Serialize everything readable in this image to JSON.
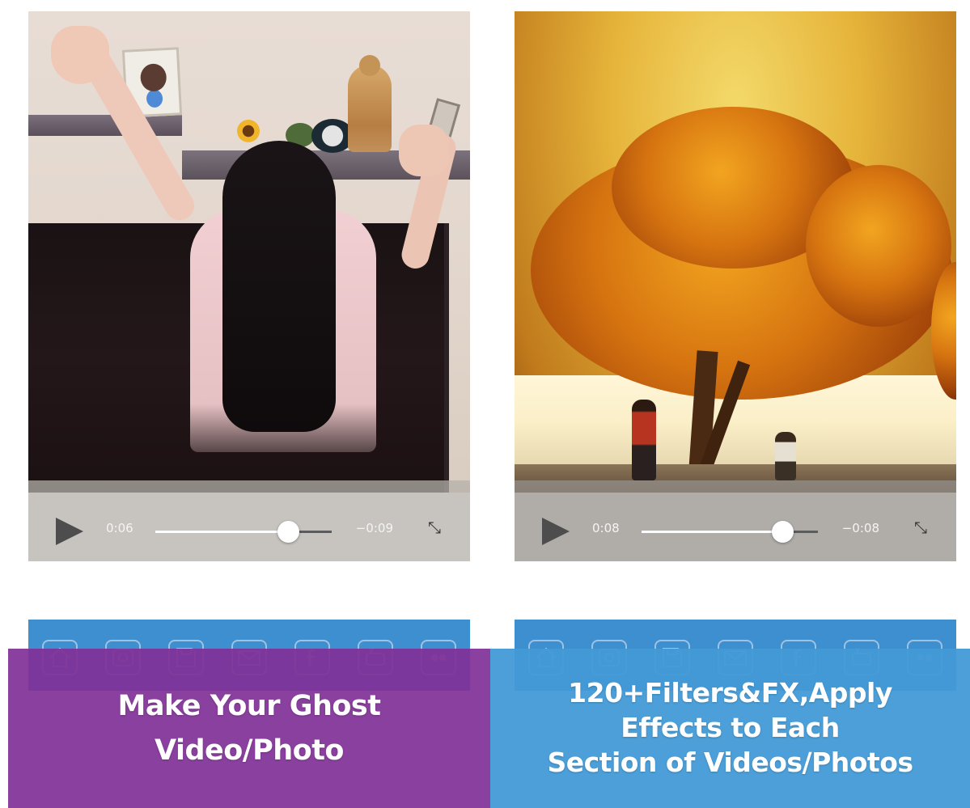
{
  "left_screen": {
    "player": {
      "current_time": "0:06",
      "remaining_time": "−0:09",
      "progress": 0.75
    },
    "toolbar": [
      "home-icon",
      "instagram-icon",
      "save-icon",
      "mail-icon",
      "facebook-icon",
      "youtube-icon",
      "flickr-icon"
    ]
  },
  "right_screen": {
    "player": {
      "current_time": "0:08",
      "remaining_time": "−0:08",
      "progress": 0.8
    },
    "toolbar": [
      "home-icon",
      "instagram-icon",
      "save-icon",
      "mail-icon",
      "facebook-icon",
      "youtube-icon",
      "flickr-icon"
    ]
  },
  "banners": {
    "left": [
      "Make Your Ghost",
      "Video/Photo"
    ],
    "right": [
      "120+Filters&FX,Apply",
      "Effects to Each",
      "Section of Videos/Photos"
    ]
  },
  "colors": {
    "purple_banner": "#80309a",
    "blue_banner": "#429ad6",
    "toolbar": "#3d8fd0"
  }
}
